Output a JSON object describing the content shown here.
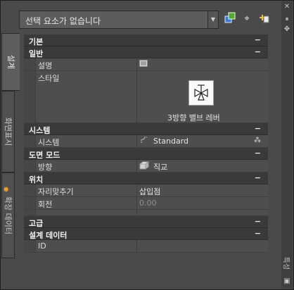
{
  "selector": {
    "text": "선택 요소가 없습니다"
  },
  "left_tabs": [
    "설계",
    "화면표시",
    "확장 데이터"
  ],
  "right_strip": {
    "vertical_label": "특성"
  },
  "sections": {
    "basic": "기본",
    "general": "일반",
    "system": "시스템",
    "display": "도면 모드",
    "location": "위치",
    "advanced": "고급",
    "design_data": "설계 데이터"
  },
  "toggle": "−",
  "rows": {
    "description": {
      "label": "설명"
    },
    "style": {
      "label": "스타일",
      "caption": "3방향 밸브 레버"
    },
    "system": {
      "label": "시스템",
      "value": "Standard"
    },
    "direction": {
      "label": "방향",
      "value": "직교"
    },
    "placement": {
      "label": "자리맞추기",
      "value": "삽입점"
    },
    "rotation": {
      "label": "회전",
      "value": "0.00"
    },
    "id": {
      "label": "ID"
    }
  }
}
